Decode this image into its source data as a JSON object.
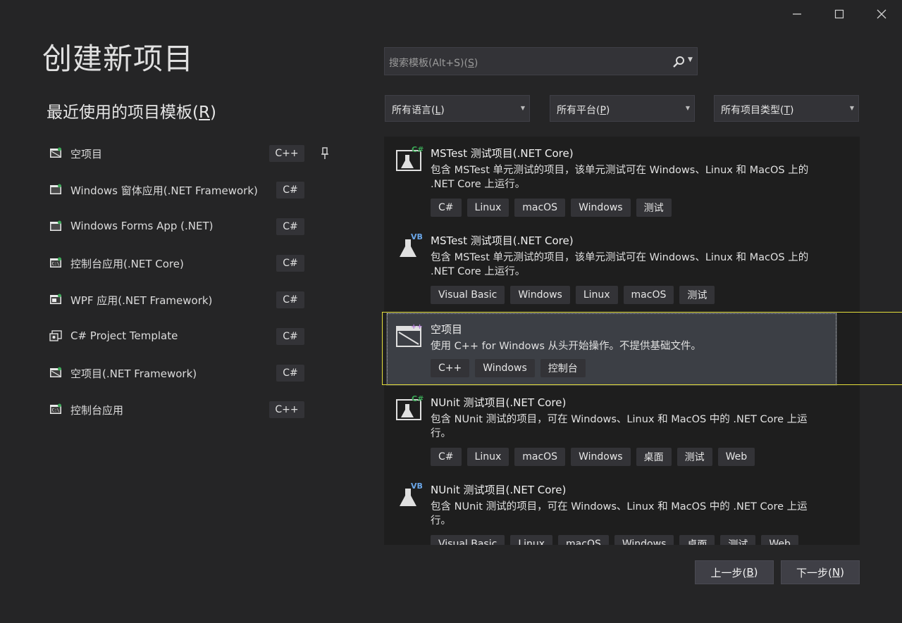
{
  "window": {
    "minimize_icon": "minimize-icon",
    "maximize_icon": "maximize-icon",
    "close_icon": "close-icon"
  },
  "title": "创建新项目",
  "recent": {
    "heading": "最近使用的项目模板(",
    "heading_key": "R",
    "heading_end": ")",
    "items": [
      {
        "label": "空项目",
        "lang": "C++",
        "icon": "empty-project-icon",
        "pinned": true
      },
      {
        "label": "Windows 窗体应用(.NET Framework)",
        "lang": "C#",
        "icon": "windows-forms-icon"
      },
      {
        "label": "Windows Forms App (.NET)",
        "lang": "C#",
        "icon": "windows-forms-icon"
      },
      {
        "label": "控制台应用(.NET Core)",
        "lang": "C#",
        "icon": "console-app-icon"
      },
      {
        "label": "WPF 应用(.NET Framework)",
        "lang": "C#",
        "icon": "wpf-app-icon"
      },
      {
        "label": "C# Project Template",
        "lang": "C#",
        "icon": "project-template-icon"
      },
      {
        "label": "空项目(.NET Framework)",
        "lang": "C#",
        "icon": "empty-project-icon"
      },
      {
        "label": "控制台应用",
        "lang": "C++",
        "icon": "console-app-icon"
      }
    ]
  },
  "search": {
    "placeholder_pre": "搜索模板(Alt+S)(",
    "placeholder_key": "S",
    "placeholder_end": ")",
    "icon": "search-icon"
  },
  "filters": {
    "language": {
      "pre": "所有语言(",
      "key": "L",
      "end": ")"
    },
    "platform": {
      "pre": "所有平台(",
      "key": "P",
      "end": ")"
    },
    "type": {
      "pre": "所有项目类型(",
      "key": "T",
      "end": ")"
    }
  },
  "templates": [
    {
      "name": "MSTest 测试项目(.NET Core)",
      "desc": "包含 MSTest 单元测试的项目，该单元测试可在 Windows、Linux 和 MacOS 上的 .NET Core 上运行。",
      "tags": [
        "C#",
        "Linux",
        "macOS",
        "Windows",
        "测试"
      ],
      "icon": "csharp-test-flask-icon"
    },
    {
      "name": "MSTest 测试项目(.NET Core)",
      "desc": "包含 MSTest 单元测试的项目，该单元测试可在 Windows、Linux 和 MacOS 上的 .NET Core 上运行。",
      "tags": [
        "Visual Basic",
        "Windows",
        "Linux",
        "macOS",
        "测试"
      ],
      "icon": "vb-test-flask-icon"
    },
    {
      "name": "空项目",
      "desc": "使用 C++ for Windows 从头开始操作。不提供基础文件。",
      "tags": [
        "C++",
        "Windows",
        "控制台"
      ],
      "icon": "cpp-empty-project-icon",
      "selected": true
    },
    {
      "name": "NUnit 测试项目(.NET Core)",
      "desc": "包含 NUnit 测试的项目，可在 Windows、Linux 和 MacOS 中的 .NET Core 上运行。",
      "tags": [
        "C#",
        "Linux",
        "macOS",
        "Windows",
        "桌面",
        "测试",
        "Web"
      ],
      "icon": "csharp-test-flask-icon"
    },
    {
      "name": "NUnit 测试项目(.NET Core)",
      "desc": "包含 NUnit 测试的项目，可在 Windows、Linux 和 MacOS 中的 .NET Core 上运行。",
      "tags": [
        "Visual Basic",
        "Linux",
        "macOS",
        "Windows",
        "桌面",
        "测试",
        "Web"
      ],
      "icon": "vb-test-flask-icon"
    }
  ],
  "buttons": {
    "back": {
      "pre": "上一步(",
      "key": "B",
      "end": ")"
    },
    "next": {
      "pre": "下一步(",
      "key": "N",
      "end": ")"
    }
  },
  "colors": {
    "background": "#252526",
    "panel": "#1e1e1e",
    "selection_frame": "#e5df3b",
    "tag_bg": "#333337"
  }
}
